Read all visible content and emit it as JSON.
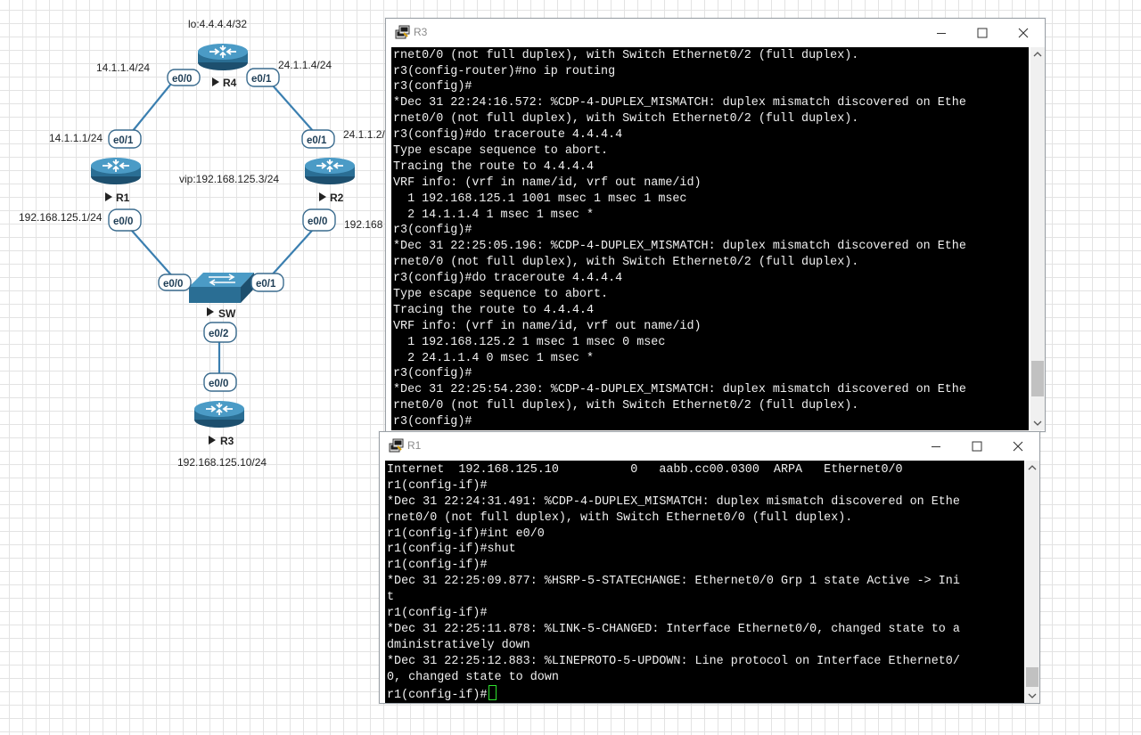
{
  "topology": {
    "loopback_label": "lo:4.4.4.4/32",
    "vip_label": "vip:192.168.125.3/24",
    "devices": {
      "r4": {
        "name": "R4",
        "if_left": "e0/0",
        "if_right": "e0/1",
        "ip_left": "14.1.1.4/24",
        "ip_right": "24.1.1.4/24"
      },
      "r1": {
        "name": "R1",
        "if_top": "e0/1",
        "if_bottom": "e0/0",
        "ip_top": "14.1.1.1/24",
        "ip_bottom": "192.168.125.1/24"
      },
      "r2": {
        "name": "R2",
        "if_top": "e0/1",
        "if_bottom": "e0/0",
        "ip_top": "24.1.1.2/",
        "ip_bottom": "192.168"
      },
      "sw": {
        "name": "SW",
        "if_left": "e0/0",
        "if_right": "e0/1",
        "if_bottom": "e0/2"
      },
      "r3": {
        "name": "R3",
        "if_top": "e0/0",
        "ip": "192.168.125.10/24"
      }
    }
  },
  "windows": {
    "r3": {
      "title": "R3",
      "lines": [
        "rnet0/0 (not full duplex), with Switch Ethernet0/2 (full duplex).",
        "r3(config-router)#no ip routing",
        "r3(config)#",
        "*Dec 31 22:24:16.572: %CDP-4-DUPLEX_MISMATCH: duplex mismatch discovered on Ethe",
        "rnet0/0 (not full duplex), with Switch Ethernet0/2 (full duplex).",
        "r3(config)#do traceroute 4.4.4.4",
        "Type escape sequence to abort.",
        "Tracing the route to 4.4.4.4",
        "VRF info: (vrf in name/id, vrf out name/id)",
        "  1 192.168.125.1 1001 msec 1 msec 1 msec",
        "  2 14.1.1.4 1 msec 1 msec *",
        "r3(config)#",
        "*Dec 31 22:25:05.196: %CDP-4-DUPLEX_MISMATCH: duplex mismatch discovered on Ethe",
        "rnet0/0 (not full duplex), with Switch Ethernet0/2 (full duplex).",
        "r3(config)#do traceroute 4.4.4.4",
        "Type escape sequence to abort.",
        "Tracing the route to 4.4.4.4",
        "VRF info: (vrf in name/id, vrf out name/id)",
        "  1 192.168.125.2 1 msec 1 msec 0 msec",
        "  2 24.1.1.4 0 msec 1 msec *",
        "r3(config)#",
        "*Dec 31 22:25:54.230: %CDP-4-DUPLEX_MISMATCH: duplex mismatch discovered on Ethe",
        "rnet0/0 (not full duplex), with Switch Ethernet0/2 (full duplex).",
        "r3(config)#"
      ]
    },
    "r1": {
      "title": "R1",
      "lines": [
        "Internet  192.168.125.10          0   aabb.cc00.0300  ARPA   Ethernet0/0",
        "r1(config-if)#",
        "*Dec 31 22:24:31.491: %CDP-4-DUPLEX_MISMATCH: duplex mismatch discovered on Ethe",
        "rnet0/0 (not full duplex), with Switch Ethernet0/0 (full duplex).",
        "r1(config-if)#int e0/0",
        "r1(config-if)#shut",
        "r1(config-if)#",
        "*Dec 31 22:25:09.877: %HSRP-5-STATECHANGE: Ethernet0/0 Grp 1 state Active -> Ini",
        "t",
        "r1(config-if)#",
        "*Dec 31 22:25:11.878: %LINK-5-CHANGED: Interface Ethernet0/0, changed state to a",
        "dministratively down",
        "*Dec 31 22:25:12.883: %LINEPROTO-5-UPDOWN: Line protocol on Interface Ethernet0/",
        "0, changed state to down",
        "r1(config-if)#"
      ]
    }
  }
}
